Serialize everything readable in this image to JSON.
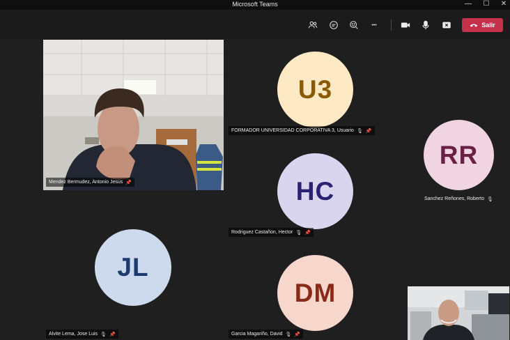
{
  "window": {
    "title": "Microsoft Teams",
    "minimize_glyph": "—",
    "maximize_glyph": "☐",
    "close_glyph": "✕"
  },
  "toolbar": {
    "leave_label": "Salir",
    "more_glyph": "•••",
    "icons": [
      "people-icon",
      "chat-icon",
      "reactions-icon",
      "more-icon",
      "camera-icon",
      "mic-icon",
      "share-icon",
      "phone-hangup-icon"
    ],
    "leave_color": "#c4314b"
  },
  "participants": [
    {
      "name": "Mendez Bermudez, Antonio Jesus",
      "type": "video",
      "muted": false,
      "pinned": true
    },
    {
      "name": "FORMADOR UNIVERSIDAD CORPORATIVA 3, Usuario",
      "initials": "U3",
      "bg": "#fde9c4",
      "fg": "#8a5a06",
      "muted": true,
      "pinned": true
    },
    {
      "name": "Sanchez Reñones, Roberto",
      "initials": "RR",
      "bg": "#f1d4e1",
      "fg": "#6a2045",
      "muted": true,
      "pinned": false
    },
    {
      "name": "Rodriguez Castañon, Hector",
      "initials": "HC",
      "bg": "#d9d5ee",
      "fg": "#2a2170",
      "muted": true,
      "pinned": true
    },
    {
      "name": "Alvite Lema, Jose Luis",
      "initials": "JL",
      "bg": "#cdd9ec",
      "fg": "#1c3a6e",
      "muted": true,
      "pinned": true
    },
    {
      "name": "Garcia Magariño, David",
      "initials": "DM",
      "bg": "#f7d6cc",
      "fg": "#8a2a16",
      "muted": true,
      "pinned": true
    }
  ],
  "self_view": {
    "type": "video"
  }
}
